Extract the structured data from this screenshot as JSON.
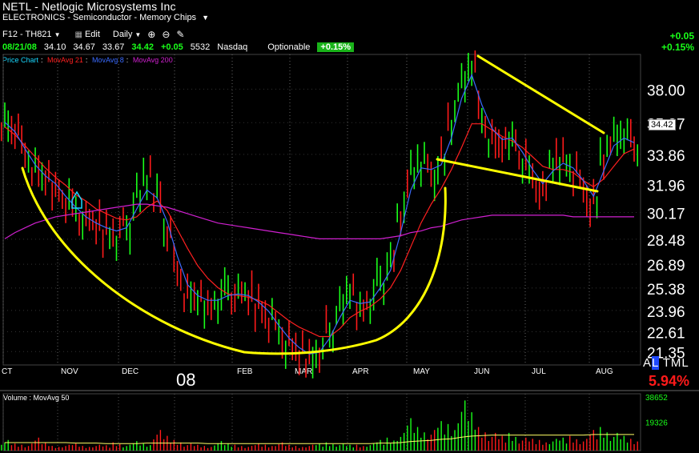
{
  "header": {
    "title": "NETL - Netlogic Microsystems Inc",
    "sector": "ELECTRONICS - Semiconductor - Memory Chips",
    "toolbar": {
      "layout": "F12 - TH821",
      "edit": "Edit",
      "period": "Daily"
    },
    "quote": {
      "date": "08/21/08",
      "open": "34.10",
      "high": "34.67",
      "low": "33.67",
      "last": "34.42",
      "change": "+0.05",
      "volume": "5532",
      "exchange": "Nasdaq",
      "optionable": "Optionable",
      "pct_change": "+0.15%"
    },
    "right_change": "+0.05",
    "right_pct": "+0.15%",
    "legend": {
      "price": "Price Chart",
      "ma21": "MovAvg 21",
      "ma8": "MovAvg 8",
      "ma200": "MovAvg 200"
    },
    "colors": {
      "ma21": "#ff2020",
      "ma8": "#3a6bff",
      "ma200": "#d020d0",
      "up": "#19ff19",
      "down": "#ff1a1a",
      "annotation": "#ffff00",
      "legend_price": "#19d8ff"
    }
  },
  "price_tag": "34.42",
  "bottom_right": {
    "al_prefix": "A",
    "al_selected": "L",
    "al_suffix": " TML",
    "pct": "5.94%"
  },
  "year_label": "08",
  "volume": {
    "legend": "Volume : MovAvg 50",
    "max_label": "38652",
    "mid_label": "19326"
  },
  "chart_data": {
    "type": "line",
    "title": "",
    "xlabel": "",
    "ylabel": "",
    "x_ticks": [
      "CT",
      "NOV",
      "DEC",
      "FEB",
      "MAR",
      "APR",
      "MAY",
      "JUN",
      "JUL",
      "AUG"
    ],
    "y_ticks": [
      "38.00",
      "35.87",
      "33.86",
      "31.96",
      "30.17",
      "28.48",
      "26.89",
      "25.38",
      "23.96",
      "22.61",
      "21.35"
    ],
    "ylim": [
      20.5,
      40.2
    ],
    "series": [
      {
        "name": "Price",
        "color": "#19ff19",
        "values": [
          36.0,
          35.5,
          34.0,
          32.8,
          32.2,
          31.8,
          31.0,
          30.2,
          29.6,
          29.3,
          29.0,
          28.8,
          29.2,
          31.0,
          32.3,
          31.5,
          29.0,
          26.5,
          24.8,
          24.6,
          24.3,
          24.6,
          25.2,
          25.0,
          24.8,
          24.3,
          23.6,
          22.6,
          21.6,
          21.2,
          21.0,
          21.3,
          22.6,
          24.0,
          25.0,
          24.2,
          24.6,
          25.8,
          27.0,
          29.8,
          32.8,
          33.5,
          32.6,
          33.3,
          35.8,
          38.5,
          39.5,
          36.2,
          34.6,
          34.3,
          35.0,
          33.5,
          32.3,
          31.5,
          33.2,
          33.6,
          32.9,
          31.6,
          30.6,
          33.6,
          35.1,
          35.2,
          34.4
        ]
      },
      {
        "name": "MovAvg 21",
        "color": "#ff2020",
        "values": [
          35.6,
          35.1,
          34.4,
          33.7,
          33.0,
          32.4,
          31.9,
          31.3,
          30.9,
          30.4,
          30.1,
          29.8,
          29.7,
          29.9,
          30.5,
          30.9,
          30.3,
          29.1,
          27.9,
          26.8,
          26.0,
          25.4,
          25.0,
          24.9,
          24.8,
          24.6,
          24.3,
          23.8,
          23.3,
          22.9,
          22.6,
          22.3,
          22.3,
          22.8,
          23.5,
          23.9,
          24.2,
          24.7,
          25.4,
          26.5,
          28.0,
          29.5,
          30.7,
          31.7,
          32.9,
          34.3,
          35.8,
          35.8,
          35.4,
          35.0,
          34.7,
          34.3,
          33.7,
          33.1,
          32.9,
          32.9,
          32.7,
          32.2,
          31.8,
          32.3,
          33.1,
          33.9,
          34.2
        ]
      },
      {
        "name": "MovAvg 8",
        "color": "#3a6bff",
        "values": [
          35.9,
          35.3,
          34.2,
          33.2,
          32.5,
          32.0,
          31.2,
          30.5,
          29.9,
          29.5,
          29.2,
          29.0,
          29.2,
          30.4,
          31.6,
          31.1,
          29.6,
          27.4,
          25.6,
          24.9,
          24.6,
          24.6,
          24.9,
          25.0,
          24.9,
          24.5,
          23.9,
          23.0,
          22.2,
          21.6,
          21.2,
          21.3,
          22.2,
          23.5,
          24.6,
          24.4,
          24.5,
          25.4,
          26.5,
          28.9,
          31.6,
          33.0,
          32.9,
          33.2,
          34.9,
          37.4,
          38.9,
          37.0,
          35.5,
          34.8,
          34.9,
          34.0,
          32.9,
          32.0,
          32.8,
          33.3,
          33.0,
          32.2,
          31.2,
          32.8,
          34.4,
          34.9,
          34.6
        ]
      },
      {
        "name": "MovAvg 200",
        "color": "#d020d0",
        "values": [
          28.5,
          28.9,
          29.2,
          29.5,
          29.7,
          29.9,
          30.0,
          30.1,
          30.2,
          30.3,
          30.4,
          30.5,
          30.6,
          30.7,
          30.7,
          30.6,
          30.5,
          30.3,
          30.1,
          29.9,
          29.7,
          29.5,
          29.4,
          29.3,
          29.2,
          29.1,
          29.0,
          28.9,
          28.8,
          28.7,
          28.6,
          28.5,
          28.5,
          28.5,
          28.5,
          28.5,
          28.5,
          28.5,
          28.6,
          28.7,
          28.9,
          29.0,
          29.2,
          29.3,
          29.5,
          29.7,
          29.8,
          29.9,
          30.0,
          30.0,
          30.0,
          30.0,
          30.0,
          30.0,
          30.0,
          30.0,
          29.9,
          29.9,
          29.9,
          29.9,
          29.9,
          29.9,
          29.9
        ]
      }
    ],
    "volume_values": [
      0.18,
      0.12,
      0.1,
      0.22,
      0.14,
      0.08,
      0.1,
      0.12,
      0.08,
      0.1,
      0.09,
      0.14,
      0.1,
      0.16,
      0.12,
      0.35,
      0.25,
      0.18,
      0.12,
      0.1,
      0.08,
      0.16,
      0.12,
      0.1,
      0.08,
      0.12,
      0.1,
      0.14,
      0.1,
      0.08,
      0.1,
      0.12,
      0.14,
      0.12,
      0.1,
      0.1,
      0.12,
      0.18,
      0.22,
      0.3,
      0.55,
      0.4,
      0.35,
      0.5,
      0.45,
      0.85,
      0.65,
      0.4,
      0.3,
      0.25,
      0.3,
      0.22,
      0.2,
      0.18,
      0.2,
      0.22,
      0.25,
      0.2,
      0.35,
      0.4,
      0.3,
      0.25,
      0.2
    ],
    "volume_ma": [
      0.15,
      0.15,
      0.15,
      0.15,
      0.15,
      0.15,
      0.15,
      0.14,
      0.14,
      0.14,
      0.13,
      0.13,
      0.13,
      0.13,
      0.14,
      0.14,
      0.14,
      0.14,
      0.14,
      0.14,
      0.13,
      0.13,
      0.13,
      0.13,
      0.13,
      0.13,
      0.13,
      0.13,
      0.13,
      0.13,
      0.13,
      0.13,
      0.13,
      0.13,
      0.13,
      0.13,
      0.13,
      0.14,
      0.14,
      0.15,
      0.17,
      0.18,
      0.19,
      0.21,
      0.22,
      0.25,
      0.27,
      0.28,
      0.29,
      0.29,
      0.29,
      0.29,
      0.29,
      0.29,
      0.29,
      0.29,
      0.29,
      0.29,
      0.3,
      0.3,
      0.3,
      0.3,
      0.3
    ],
    "grid": true,
    "legend_position": "top-left"
  }
}
